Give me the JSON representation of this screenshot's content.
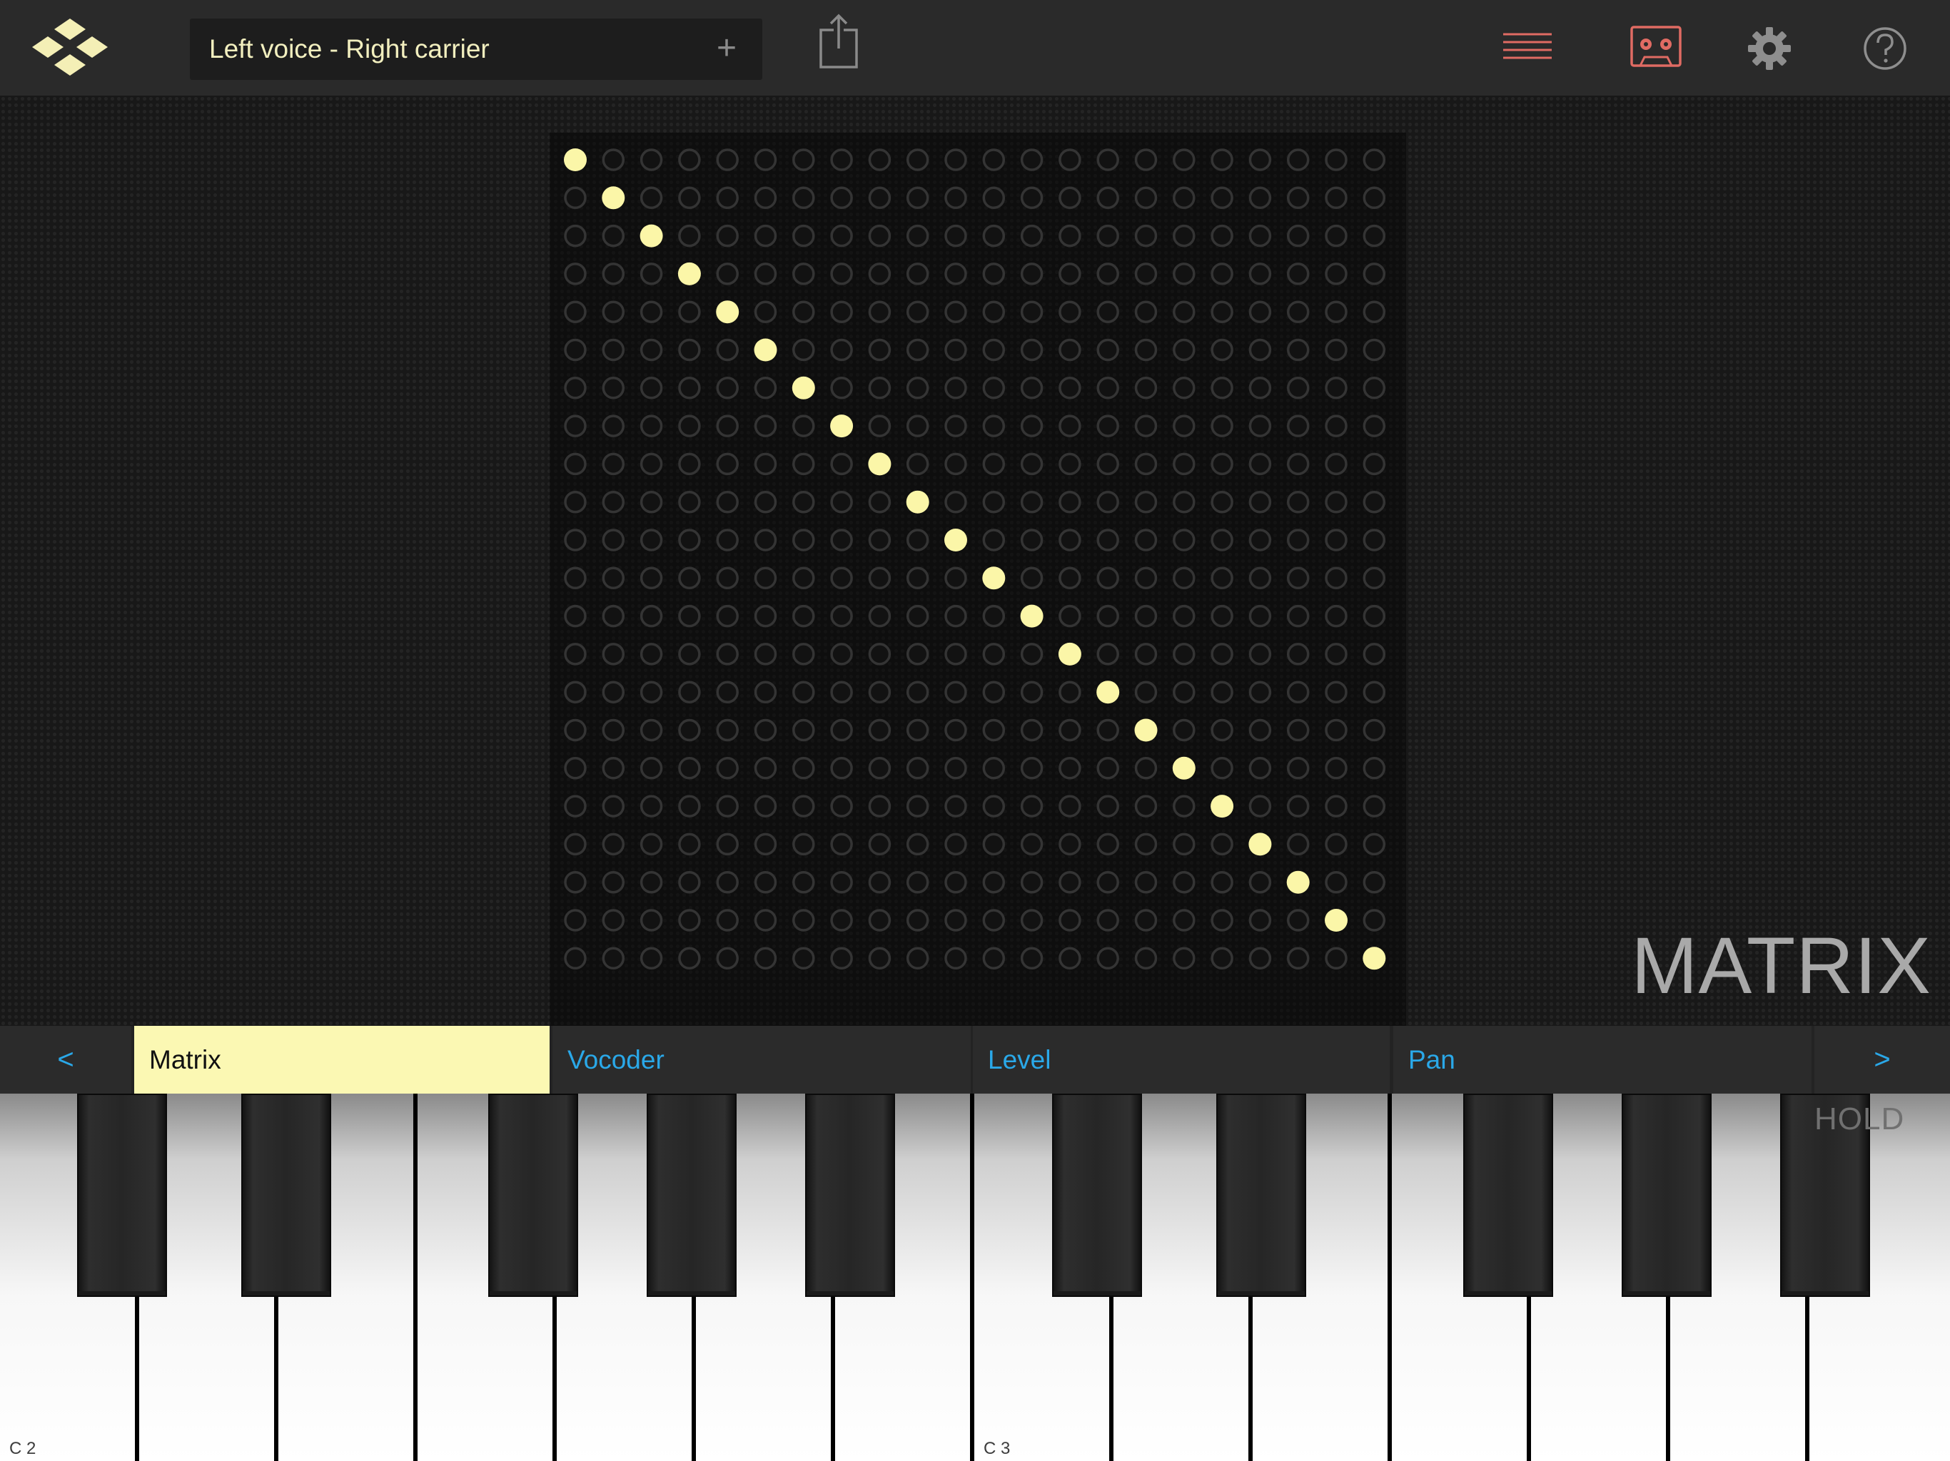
{
  "header": {
    "logo": "diamond-logo-icon",
    "preset_name": "Left voice - Right carrier",
    "add_label": "+",
    "buttons": {
      "share": "share-icon",
      "list": "list-icon",
      "recorder": "cassette-icon",
      "settings": "gear-icon",
      "help": "help-icon"
    },
    "colors": {
      "accent": "#f2efbf",
      "red_icons": "#e06b63"
    }
  },
  "matrix": {
    "title": "MATRIX",
    "rows": 22,
    "cols": 22,
    "active_cells": [
      [
        0,
        0
      ],
      [
        1,
        1
      ],
      [
        2,
        2
      ],
      [
        3,
        3
      ],
      [
        4,
        4
      ],
      [
        5,
        5
      ],
      [
        6,
        6
      ],
      [
        7,
        7
      ],
      [
        8,
        8
      ],
      [
        9,
        9
      ],
      [
        10,
        10
      ],
      [
        11,
        11
      ],
      [
        12,
        12
      ],
      [
        13,
        13
      ],
      [
        14,
        14
      ],
      [
        15,
        15
      ],
      [
        16,
        16
      ],
      [
        17,
        17
      ],
      [
        18,
        18
      ],
      [
        19,
        19
      ],
      [
        20,
        20
      ],
      [
        21,
        21
      ]
    ],
    "colors": {
      "active": "#fbf6a8",
      "inactive_ring": "#343434"
    }
  },
  "tabs": {
    "prev_label": "<",
    "next_label": ">",
    "items": [
      {
        "label": "Matrix",
        "active": true
      },
      {
        "label": "Vocoder",
        "active": false
      },
      {
        "label": "Level",
        "active": false
      },
      {
        "label": "Pan",
        "active": false
      }
    ],
    "colors": {
      "active_bg": "#fbf8b3",
      "link": "#2aa8e8"
    }
  },
  "keyboard": {
    "octaves": [
      "C 2",
      "C 3"
    ],
    "hold_label": "HOLD"
  }
}
